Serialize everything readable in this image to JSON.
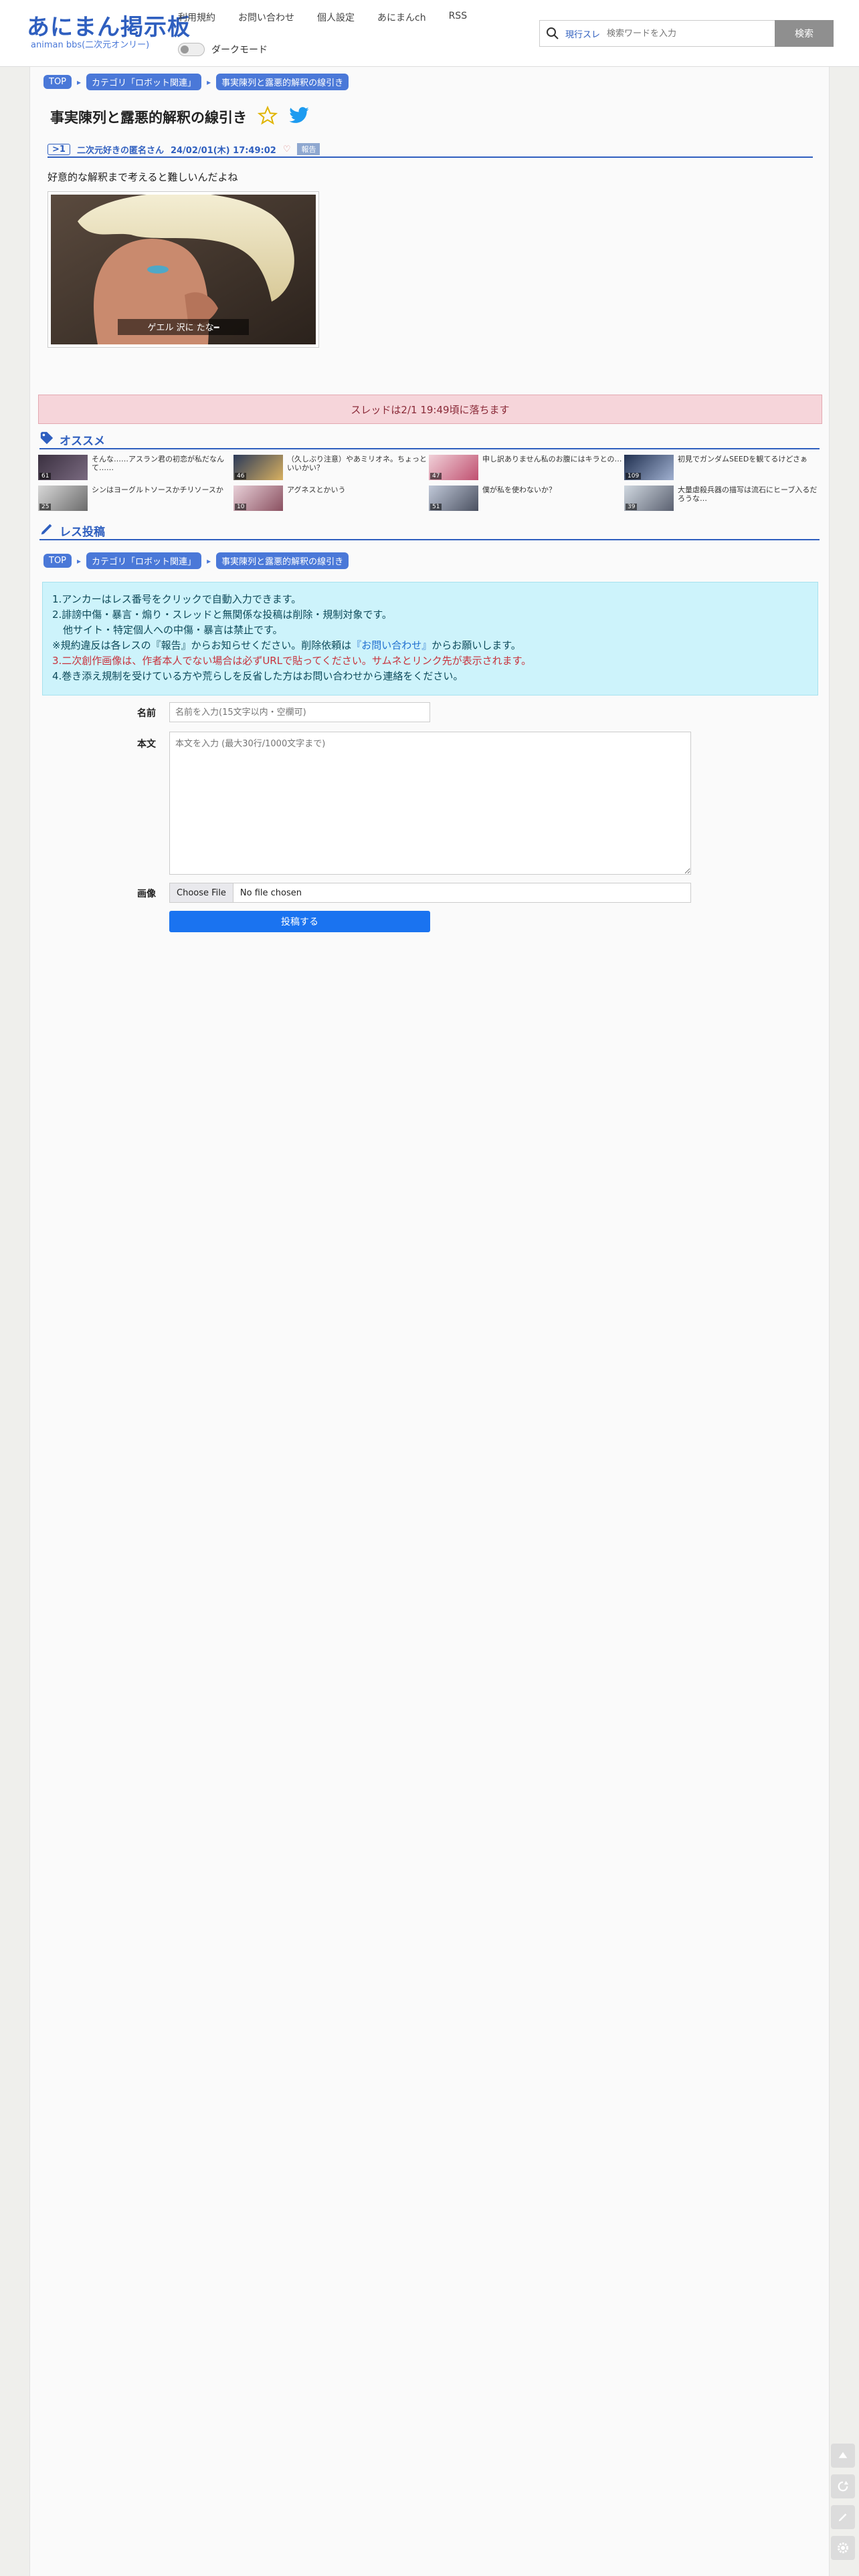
{
  "site": {
    "logo": "あにまん掲示板",
    "sub": "animan bbs(二次元オンリー)"
  },
  "nav": [
    "利用規約",
    "お問い合わせ",
    "個人設定",
    "あにまんch",
    "RSS"
  ],
  "dark_mode_label": "ダークモード",
  "search": {
    "scope": "現行スレ",
    "placeholder": "検索ワードを入力",
    "button": "検索"
  },
  "breadcrumb": [
    "TOP",
    "カテゴリ「ロボット関連」",
    "事実陳列と露悪的解釈の線引き"
  ],
  "thread": {
    "title": "事実陳列と露悪的解釈の線引き"
  },
  "post": {
    "no": ">1",
    "author": "二次元好きの匿名さん",
    "date": "24/02/01(木) 17:49:02",
    "report": "報告",
    "body": "好意的な解釈まで考えると難しいんだよね",
    "image_caption": "ゲエル 沢に たな━"
  },
  "closed_notice": "スレッドは2/1 19:49頃に落ちます",
  "recommend": {
    "title": "オススメ",
    "items": [
      {
        "text": "そんな……アスラン君の初恋が私だなんて……",
        "count": "61"
      },
      {
        "text": "（久しぶり注意）やあミリオネ。ちょっといいかい？",
        "count": "46"
      },
      {
        "text": "申し訳ありません私のお腹にはキラとの…",
        "count": "47"
      },
      {
        "text": "初見でガンダムSEEDを観てるけどさぁ",
        "count": "109"
      },
      {
        "text": "シンはヨーグルトソースかチリソースか",
        "count": "25"
      },
      {
        "text": "アグネスとかいう",
        "count": "10"
      },
      {
        "text": "僕が私を使わないか？",
        "count": "51"
      },
      {
        "text": "大量虐殺兵器の描写は流石にヒーブ入るだろうな…",
        "count": "39"
      }
    ]
  },
  "reply": {
    "title": "レス投稿",
    "rules": [
      "1.アンカーはレス番号をクリックで自動入力できます。",
      "2.誹謗中傷・暴言・煽り・スレッドと無関係な投稿は削除・規制対象です。",
      "他サイト・特定個人への中傷・暴言は禁止です。",
      "※規約違反は各レスの『報告』からお知らせください。削除依頼は",
      "『お問い合わせ』",
      "からお願いします。",
      "3.二次創作画像は、",
      "作者本人でない場合は必ずURLで貼ってください。サムネとリンク先が表示されます。",
      "4.巻き添え規制を受けている方や荒らしを反省した方はお問い合わせから連絡をください。"
    ],
    "name_label": "名前",
    "name_placeholder": "名前を入力(15文字以内・空欄可)",
    "body_label": "本文",
    "body_placeholder": "本文を入力 (最大30行/1000文字まで)",
    "image_label": "画像",
    "choose_file": "Choose File",
    "no_file": "No file chosen",
    "submit": "投稿する"
  },
  "colors": {
    "accent": "#2f5fbf",
    "notice_bg": "#f6d5da",
    "info_bg": "#cdf3fb",
    "submit": "#1a73f0"
  }
}
